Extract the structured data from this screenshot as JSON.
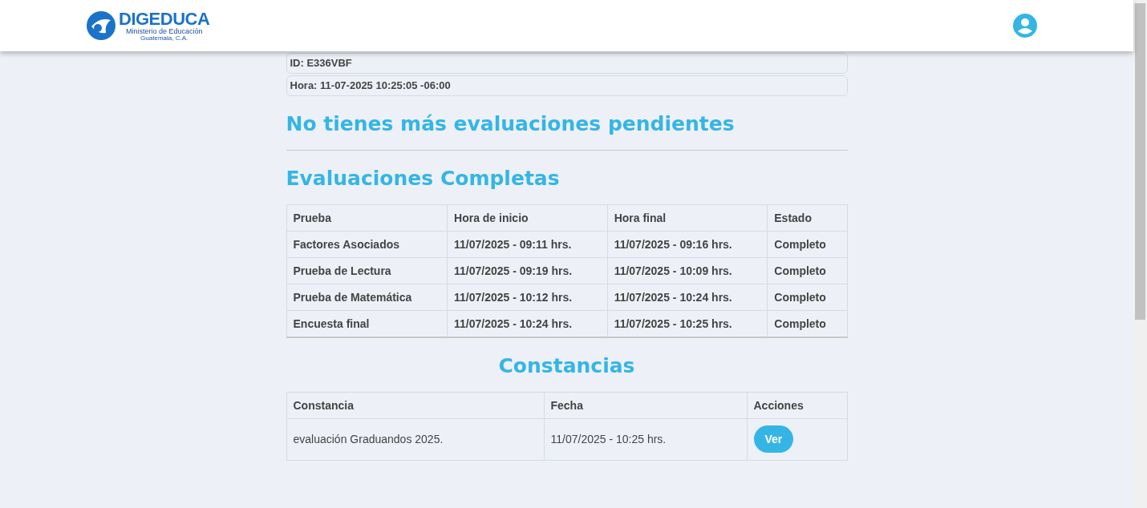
{
  "header": {
    "logo": {
      "name": "DIGEDUCA",
      "subtitle": "Ministerio de Educación",
      "location": "Guatemala, C.A."
    }
  },
  "info": [
    "ID: E336VBF",
    "Hora: 11-07-2025 10:25:05 -06:00"
  ],
  "pending_title": "No tienes más evaluaciones pendientes",
  "completed": {
    "title": "Evaluaciones Completas",
    "columns": [
      "Prueba",
      "Hora de inicio",
      "Hora final",
      "Estado"
    ],
    "rows": [
      [
        "Factores Asociados",
        "11/07/2025 - 09:11 hrs.",
        "11/07/2025 - 09:16 hrs.",
        "Completo"
      ],
      [
        "Prueba de Lectura",
        "11/07/2025 - 09:19 hrs.",
        "11/07/2025 - 10:09 hrs.",
        "Completo"
      ],
      [
        "Prueba de Matemática",
        "11/07/2025 - 10:12 hrs.",
        "11/07/2025 - 10:24 hrs.",
        "Completo"
      ],
      [
        "Encuesta final",
        "11/07/2025 - 10:24 hrs.",
        "11/07/2025 - 10:25 hrs.",
        "Completo"
      ]
    ]
  },
  "certificates": {
    "title": "Constancias",
    "columns": [
      "Constancia",
      "Fecha",
      "Acciones"
    ],
    "rows": [
      {
        "name": "evaluación Graduandos 2025.",
        "date": "11/07/2025 - 10:25 hrs.",
        "action": "Ver"
      }
    ]
  }
}
